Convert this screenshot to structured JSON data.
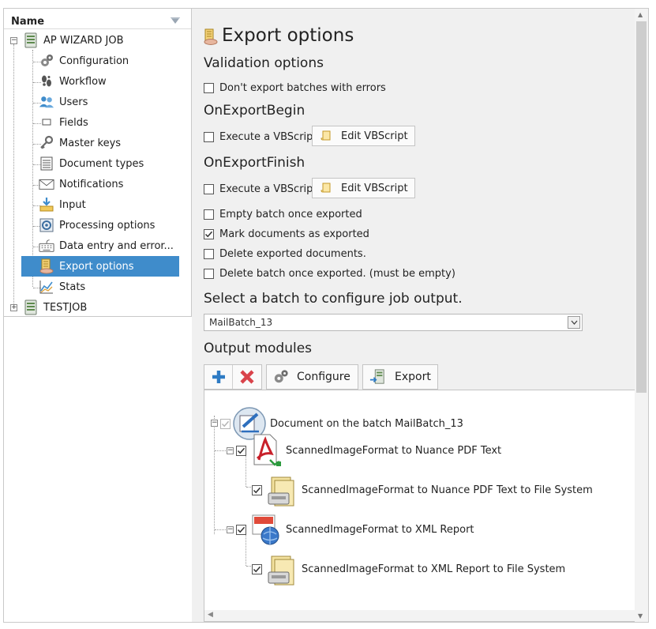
{
  "tree": {
    "header": "Name",
    "jobs": [
      {
        "label": "AP WIZARD JOB",
        "expander": "−",
        "children": [
          {
            "label": "Configuration",
            "icon": "gears-icon"
          },
          {
            "label": "Workflow",
            "icon": "footprints-icon"
          },
          {
            "label": "Users",
            "icon": "users-icon"
          },
          {
            "label": "Fields",
            "icon": "field-icon"
          },
          {
            "label": "Master keys",
            "icon": "key-icon"
          },
          {
            "label": "Document types",
            "icon": "document-types-icon"
          },
          {
            "label": "Notifications",
            "icon": "envelope-icon"
          },
          {
            "label": "Input",
            "icon": "input-tray-icon"
          },
          {
            "label": "Processing options",
            "icon": "processing-icon"
          },
          {
            "label": "Data entry and error...",
            "icon": "keyboard-icon"
          },
          {
            "label": "Export options",
            "icon": "export-icon",
            "selected": true
          },
          {
            "label": "Stats",
            "icon": "chart-icon"
          }
        ]
      },
      {
        "label": "TESTJOB",
        "expander": "+"
      }
    ]
  },
  "main": {
    "title": "Export options",
    "validation": {
      "heading": "Validation options",
      "dont_export_errors": {
        "label": "Don't export batches with errors",
        "checked": false
      }
    },
    "on_begin": {
      "heading": "OnExportBegin",
      "execute_label": "Execute a VBScript",
      "checked": false,
      "edit_button": "Edit VBScript"
    },
    "on_finish": {
      "heading": "OnExportFinish",
      "execute_label": "Execute a VBScript",
      "checked": false,
      "edit_button": "Edit VBScript"
    },
    "options": [
      {
        "label": "Empty batch once exported",
        "checked": false
      },
      {
        "label": "Mark documents as exported",
        "checked": true
      },
      {
        "label": "Delete exported documents.",
        "checked": false
      },
      {
        "label": "Delete batch once exported. (must be empty)",
        "checked": false
      }
    ],
    "batch": {
      "heading": "Select a batch to configure job output.",
      "selected": "MailBatch_13"
    },
    "modules": {
      "heading": "Output modules",
      "configure_label": "Configure",
      "export_label": "Export",
      "root": "Document on the batch MailBatch_13",
      "items": [
        {
          "label": "ScannedImageFormat to Nuance PDF Text",
          "child": "ScannedImageFormat to Nuance PDF Text to File System"
        },
        {
          "label": "ScannedImageFormat to XML Report",
          "child": "ScannedImageFormat to XML Report to File System"
        }
      ]
    }
  },
  "colors": {
    "selection": "#3f8ccb",
    "add": "#2e7bc4",
    "remove": "#d9434b"
  }
}
